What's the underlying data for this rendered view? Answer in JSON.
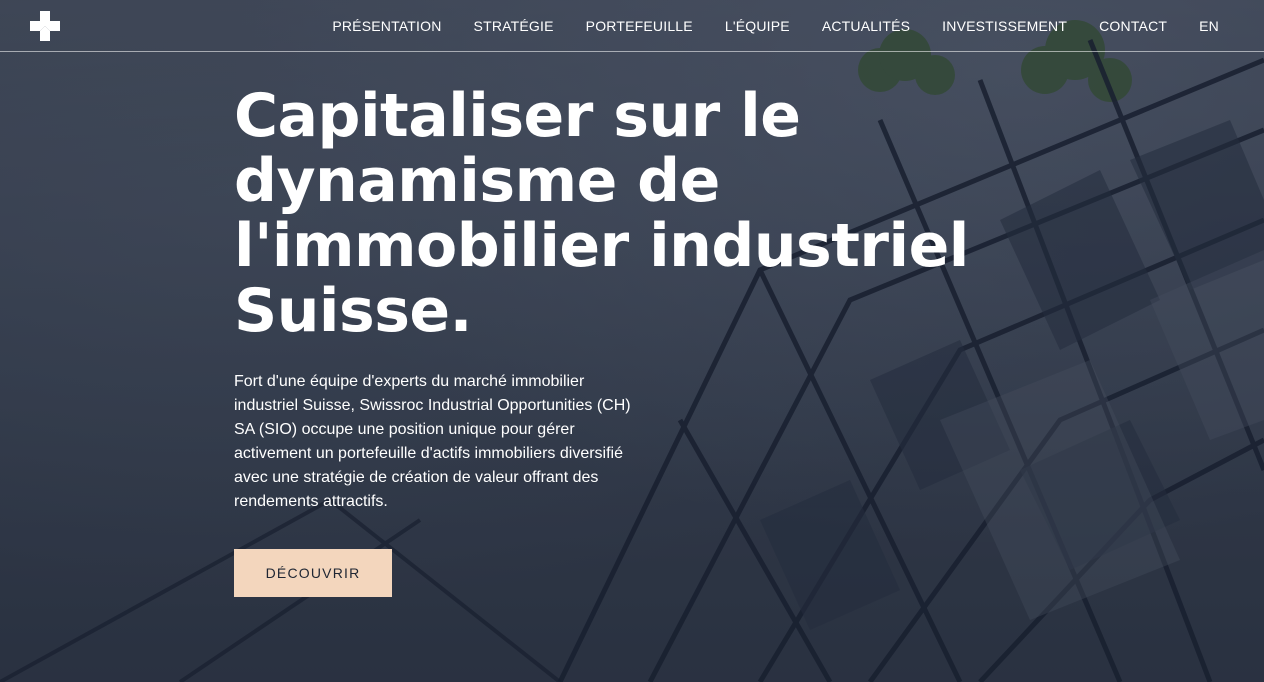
{
  "nav": {
    "items": [
      {
        "label": "PRÉSENTATION"
      },
      {
        "label": "STRATÉGIE"
      },
      {
        "label": "PORTEFEUILLE"
      },
      {
        "label": "L'ÉQUIPE"
      },
      {
        "label": "ACTUALITÉS"
      },
      {
        "label": "INVESTISSEMENT"
      },
      {
        "label": "CONTACT"
      },
      {
        "label": "EN"
      }
    ]
  },
  "hero": {
    "title_lines": [
      "Capitaliser sur le",
      "dynamisme de",
      "l'immobilier industriel",
      "Suisse."
    ],
    "paragraph": "Fort d'une équipe d'experts du marché immobilier industriel Suisse, Swissroc Industrial Opportunities (CH) SA (SIO) occupe une position unique pour gérer activement un portefeuille d'actifs immobiliers diversifié avec une stratégie de création de valeur offrant des rendements attractifs.",
    "cta_label": "DÉCOUVRIR"
  },
  "icons": {
    "logo": "swissroc-logo-icon"
  },
  "colors": {
    "cta_background": "#f3d6bd",
    "text": "#ffffff",
    "overlay": "#1e2636"
  }
}
